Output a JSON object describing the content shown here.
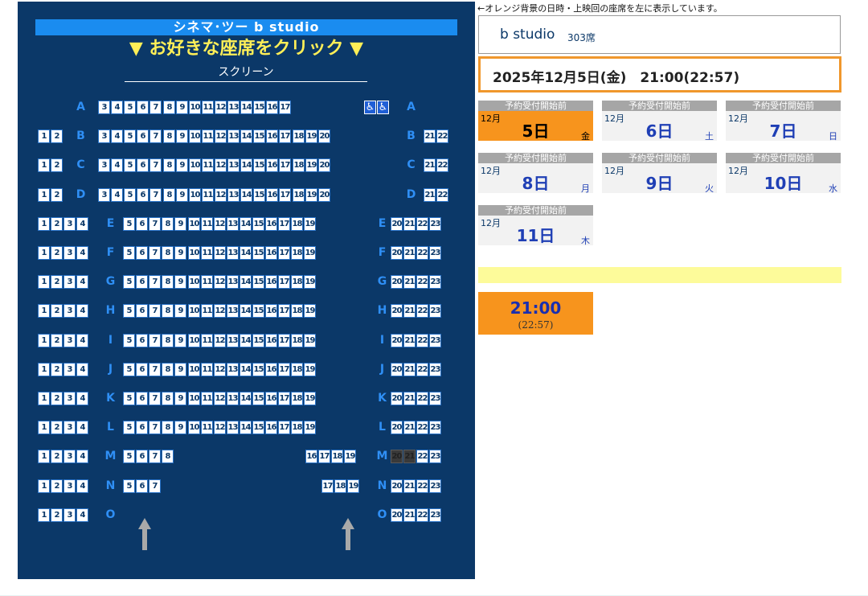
{
  "seat_map": {
    "theater_name": "シネマ･ツー b studio",
    "instruction": "▼ お好きな座席をクリック ▼",
    "screen_label": "スクリーン",
    "rows": [
      {
        "label": "A",
        "groups": [
          [
            "3",
            "4",
            "5",
            "6",
            "7",
            "8",
            "9",
            "10",
            "11",
            "12",
            "13",
            "14",
            "15",
            "16",
            "17"
          ],
          [
            "♿",
            "♿"
          ]
        ],
        "sold": []
      },
      {
        "label": "B",
        "groups": [
          [
            "1",
            "2"
          ],
          [
            "3",
            "4",
            "5",
            "6",
            "7",
            "8",
            "9",
            "10",
            "11",
            "12",
            "13",
            "14",
            "15",
            "16",
            "17",
            "18",
            "19",
            "20"
          ],
          [
            "21",
            "22"
          ]
        ],
        "sold": []
      },
      {
        "label": "C",
        "groups": [
          [
            "1",
            "2"
          ],
          [
            "3",
            "4",
            "5",
            "6",
            "7",
            "8",
            "9",
            "10",
            "11",
            "12",
            "13",
            "14",
            "15",
            "16",
            "17",
            "18",
            "19",
            "20"
          ],
          [
            "21",
            "22"
          ]
        ],
        "sold": []
      },
      {
        "label": "D",
        "groups": [
          [
            "1",
            "2"
          ],
          [
            "3",
            "4",
            "5",
            "6",
            "7",
            "8",
            "9",
            "10",
            "11",
            "12",
            "13",
            "14",
            "15",
            "16",
            "17",
            "18",
            "19",
            "20"
          ],
          [
            "21",
            "22"
          ]
        ],
        "sold": []
      },
      {
        "label": "E",
        "groups": [
          [
            "1",
            "2",
            "3",
            "4"
          ],
          [
            "5",
            "6",
            "7",
            "8",
            "9",
            "10",
            "11",
            "12",
            "13",
            "14",
            "15",
            "16",
            "17",
            "18",
            "19"
          ],
          [
            "20",
            "21",
            "22",
            "23"
          ]
        ],
        "sold": []
      },
      {
        "label": "F",
        "groups": [
          [
            "1",
            "2",
            "3",
            "4"
          ],
          [
            "5",
            "6",
            "7",
            "8",
            "9",
            "10",
            "11",
            "12",
            "13",
            "14",
            "15",
            "16",
            "17",
            "18",
            "19"
          ],
          [
            "20",
            "21",
            "22",
            "23"
          ]
        ],
        "sold": []
      },
      {
        "label": "G",
        "groups": [
          [
            "1",
            "2",
            "3",
            "4"
          ],
          [
            "5",
            "6",
            "7",
            "8",
            "9",
            "10",
            "11",
            "12",
            "13",
            "14",
            "15",
            "16",
            "17",
            "18",
            "19"
          ],
          [
            "20",
            "21",
            "22",
            "23"
          ]
        ],
        "sold": []
      },
      {
        "label": "H",
        "groups": [
          [
            "1",
            "2",
            "3",
            "4"
          ],
          [
            "5",
            "6",
            "7",
            "8",
            "9",
            "10",
            "11",
            "12",
            "13",
            "14",
            "15",
            "16",
            "17",
            "18",
            "19"
          ],
          [
            "20",
            "21",
            "22",
            "23"
          ]
        ],
        "sold": []
      },
      {
        "label": "I",
        "groups": [
          [
            "1",
            "2",
            "3",
            "4"
          ],
          [
            "5",
            "6",
            "7",
            "8",
            "9",
            "10",
            "11",
            "12",
            "13",
            "14",
            "15",
            "16",
            "17",
            "18",
            "19"
          ],
          [
            "20",
            "21",
            "22",
            "23"
          ]
        ],
        "sold": []
      },
      {
        "label": "J",
        "groups": [
          [
            "1",
            "2",
            "3",
            "4"
          ],
          [
            "5",
            "6",
            "7",
            "8",
            "9",
            "10",
            "11",
            "12",
            "13",
            "14",
            "15",
            "16",
            "17",
            "18",
            "19"
          ],
          [
            "20",
            "21",
            "22",
            "23"
          ]
        ],
        "sold": []
      },
      {
        "label": "K",
        "groups": [
          [
            "1",
            "2",
            "3",
            "4"
          ],
          [
            "5",
            "6",
            "7",
            "8",
            "9",
            "10",
            "11",
            "12",
            "13",
            "14",
            "15",
            "16",
            "17",
            "18",
            "19"
          ],
          [
            "20",
            "21",
            "22",
            "23"
          ]
        ],
        "sold": []
      },
      {
        "label": "L",
        "groups": [
          [
            "1",
            "2",
            "3",
            "4"
          ],
          [
            "5",
            "6",
            "7",
            "8",
            "9",
            "10",
            "11",
            "12",
            "13",
            "14",
            "15",
            "16",
            "17",
            "18",
            "19"
          ],
          [
            "20",
            "21",
            "22",
            "23"
          ]
        ],
        "sold": []
      },
      {
        "label": "M",
        "groups": [
          [
            "1",
            "2",
            "3",
            "4"
          ],
          [
            "5",
            "6",
            "7",
            "8"
          ],
          [
            "16",
            "17",
            "18",
            "19"
          ],
          [
            "20",
            "21",
            "22",
            "23"
          ]
        ],
        "sold": [
          "20",
          "21"
        ]
      },
      {
        "label": "N",
        "groups": [
          [
            "1",
            "2",
            "3",
            "4"
          ],
          [
            "5",
            "6",
            "7"
          ],
          [
            "17",
            "18",
            "19"
          ],
          [
            "20",
            "21",
            "22",
            "23"
          ]
        ],
        "sold": []
      },
      {
        "label": "O",
        "groups": [
          [
            "1",
            "2",
            "3",
            "4"
          ],
          [
            "20",
            "21",
            "22",
            "23"
          ]
        ],
        "sold": []
      }
    ],
    "exit_icon": "up-arrow-icon",
    "colors": {
      "background": "#0b3868",
      "header": "#1a8cf0",
      "instruction": "#ffef57",
      "row_label": "#2f8ff5",
      "sold_seat": "#3a3a3a",
      "wheelchair_seat": "#1f5fd6"
    }
  },
  "note": "←オレンジ背景の日時・上映回の座席を左に表示しています。",
  "studio": {
    "name": "b studio",
    "seats": "303席"
  },
  "selected_datetime": "2025年12月5日(金)　21:00(22:57)",
  "dates": [
    {
      "status": "予約受付開始前",
      "month": "12月",
      "day": "5日",
      "weekday": "金",
      "selected": true
    },
    {
      "status": "予約受付開始前",
      "month": "12月",
      "day": "6日",
      "weekday": "土",
      "selected": false
    },
    {
      "status": "予約受付開始前",
      "month": "12月",
      "day": "7日",
      "weekday": "日",
      "selected": false
    },
    {
      "status": "予約受付開始前",
      "month": "12月",
      "day": "8日",
      "weekday": "月",
      "selected": false
    },
    {
      "status": "予約受付開始前",
      "month": "12月",
      "day": "9日",
      "weekday": "火",
      "selected": false
    },
    {
      "status": "予約受付開始前",
      "month": "12月",
      "day": "10日",
      "weekday": "水",
      "selected": false
    },
    {
      "status": "予約受付開始前",
      "month": "12月",
      "day": "11日",
      "weekday": "木",
      "selected": false
    }
  ],
  "showtime": {
    "start": "21:00",
    "end": "(22:57)",
    "selected": true,
    "color": "#f7941d"
  },
  "accent_colors": {
    "selected": "#f7941d",
    "notice_bar": "#fdfb9a",
    "day_text": "#1f3fb5"
  }
}
